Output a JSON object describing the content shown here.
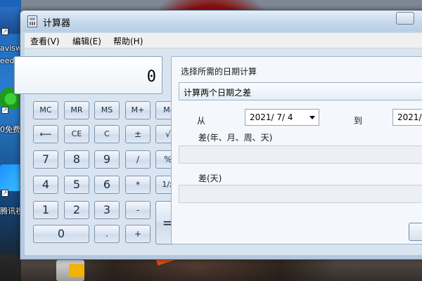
{
  "window": {
    "title": "计算器"
  },
  "menu": {
    "view": "查看(V)",
    "edit": "编辑(E)",
    "help": "帮助(H)"
  },
  "desktop": {
    "label_1": "avisw",
    "label_2": "eedo",
    "label_3": "0免费",
    "label_4": "腾讯视"
  },
  "calculator": {
    "display": "0",
    "keys": {
      "mc": "MC",
      "mr": "MR",
      "ms": "MS",
      "mplus": "M+",
      "mminus": "M-",
      "back": "⟵",
      "ce": "CE",
      "c": "C",
      "plusminus": "±",
      "sqrt": "√",
      "n7": "7",
      "n8": "8",
      "n9": "9",
      "divide": "/",
      "percent": "%",
      "n4": "4",
      "n5": "5",
      "n6": "6",
      "multiply": "*",
      "reciprocal": "1/x",
      "n1": "1",
      "n2": "2",
      "n3": "3",
      "minus": "-",
      "equals": "=",
      "n0": "0",
      "dot": ".",
      "plus": "+"
    }
  },
  "date_calc": {
    "heading": "选择所需的日期计算",
    "mode": "计算两个日期之差",
    "from_label": "从",
    "from_date": "2021/ 7/ 4",
    "to_label": "到",
    "to_date": "2021/",
    "diff_ymwd_label": "差(年、月、周、天)",
    "diff_ymwd_value": "",
    "diff_days_label": "差(天)",
    "diff_days_value": ""
  }
}
